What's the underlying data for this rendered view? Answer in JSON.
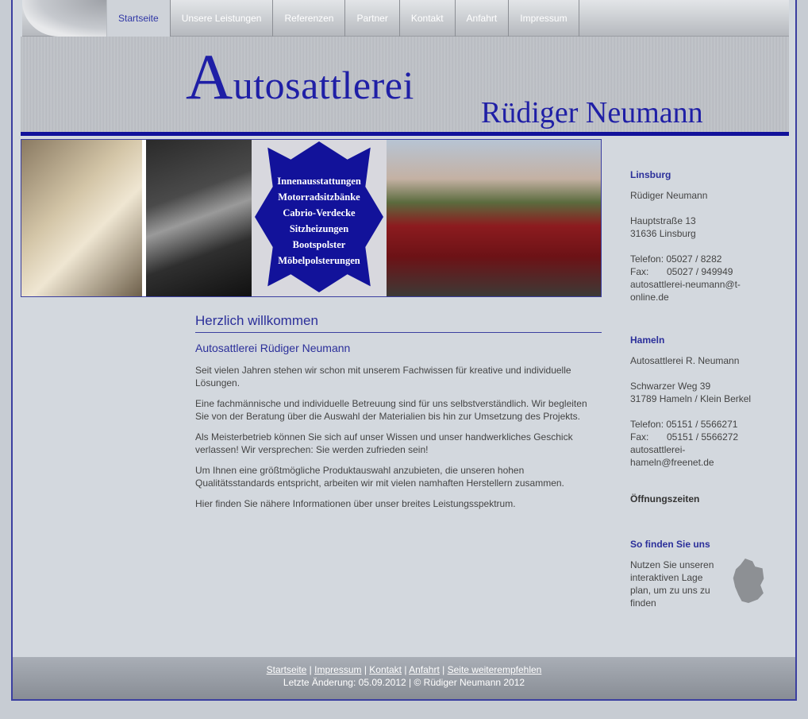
{
  "nav": {
    "items": [
      {
        "label": "Startseite",
        "active": true
      },
      {
        "label": "Unsere Leistungen"
      },
      {
        "label": "Referenzen"
      },
      {
        "label": "Partner"
      },
      {
        "label": "Kontakt"
      },
      {
        "label": "Anfahrt"
      },
      {
        "label": "Impressum"
      }
    ]
  },
  "header": {
    "logo_initial": "A",
    "logo_rest": "utosattlerei",
    "logo_sub": "Rüdiger Neumann"
  },
  "banner": {
    "services": [
      "Innenausstattungen",
      "Motorradsitzbänke",
      "Cabrio-Verdecke",
      "Sitzheizungen",
      "Bootspolster",
      "Möbelpolsterungen"
    ]
  },
  "main": {
    "welcome": "Herzlich willkommen",
    "subtitle": "Autosattlerei Rüdiger Neumann",
    "paragraphs": [
      "Seit vielen Jahren stehen wir schon mit unserem Fachwissen für kreative und individuelle Lösungen.",
      "Eine fachmännische und individuelle Betreuung sind für uns selbstverständlich. Wir begleiten Sie von der Beratung über die Auswahl der Materialien bis hin zur Umsetzung des Projekts.",
      "Als Meisterbetrieb können Sie sich auf unser Wissen und unser handwerkliches Geschick verlassen! Wir versprechen: Sie werden zufrieden sein!",
      "Um Ihnen eine größtmögliche Produktauswahl anzubieten, die unseren hohen Qualitätsstandards entspricht, arbeiten wir mit vielen namhaften Herstellern zusammen.",
      "Hier finden Sie nähere Informationen über unser breites Leistungsspektrum."
    ]
  },
  "sidebar": {
    "linsburg": {
      "title": "Linsburg",
      "name": "Rüdiger Neumann",
      "street": "Hauptstraße 13",
      "city": "31636 Linsburg",
      "phone": "Telefon: 05027 / 8282",
      "fax_label": "Fax:",
      "fax": "05027 / 949949",
      "email_1": "autosattlerei-neumann@t-",
      "email_2": "online.de"
    },
    "hameln": {
      "title": "Hameln",
      "name": "Autosattlerei R. Neumann",
      "street": "Schwarzer Weg 39",
      "city": "31789 Hameln / Klein Berkel",
      "phone": "Telefon: 05151 / 5566271",
      "fax_label": "Fax:",
      "fax": "05151 / 5566272",
      "email_1": "autosattlerei-",
      "email_2": "hameln@freenet.de"
    },
    "hours": "Öffnungszeiten",
    "map": {
      "title": "So finden Sie uns",
      "lines": [
        "Nutzen Sie unseren",
        "interaktiven Lage",
        "plan, um zu uns zu",
        "finden"
      ]
    }
  },
  "footer": {
    "links": [
      "Startseite",
      "Impressum",
      "Kontakt",
      "Anfahrt",
      "Seite weiterempfehlen"
    ],
    "separator": " | ",
    "line2": "Letzte Änderung: 05.09.2012 | © Rüdiger Neumann 2012"
  }
}
